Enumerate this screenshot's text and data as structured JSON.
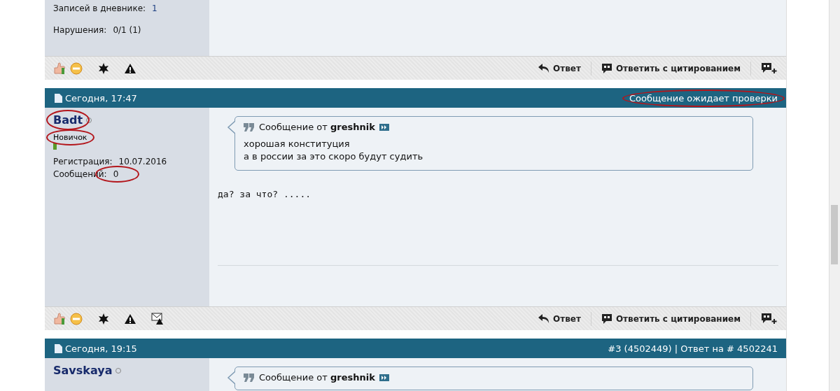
{
  "posts": [
    {
      "sidebar": {
        "stats": [
          {
            "label": "Записей в дневнике:",
            "value": "1",
            "circled": false
          },
          {
            "label": "Нарушения:",
            "value": "0/1 (1)",
            "circled": false
          }
        ]
      },
      "actions": {
        "report_button": false,
        "reply": "Ответ",
        "quote_reply": "Ответить с цитированием"
      }
    },
    {
      "header": {
        "date": "Сегодня, 17:47",
        "right": "Сообщение ожидает проверки",
        "circled": true
      },
      "sidebar": {
        "username": "Badt",
        "username_circled": true,
        "rank": "Новичок",
        "rank_circled": true,
        "reputation": true,
        "stats": [
          {
            "label": "Регистрация:",
            "value": "10.07.2016",
            "circled": false
          },
          {
            "label": "Сообщений:",
            "value": "0",
            "circled": true
          }
        ]
      },
      "quote": {
        "prefix": "Сообщение от",
        "author": "greshnik",
        "lines": [
          "хорошая конституция",
          "а в россии за это скоро будут судить"
        ]
      },
      "message": "да? за что? .....",
      "actions": {
        "report_button": true,
        "reply": "Ответ",
        "quote_reply": "Ответить с цитированием"
      }
    },
    {
      "header": {
        "date": "Сегодня, 19:15",
        "right": "#3 (4502449) | Ответ на # 4502241",
        "circled": false
      },
      "sidebar": {
        "username": "Savskaya",
        "username_circled": false,
        "reputation": false
      },
      "quote": {
        "prefix": "Сообщение от",
        "author": "greshnik"
      }
    }
  ]
}
